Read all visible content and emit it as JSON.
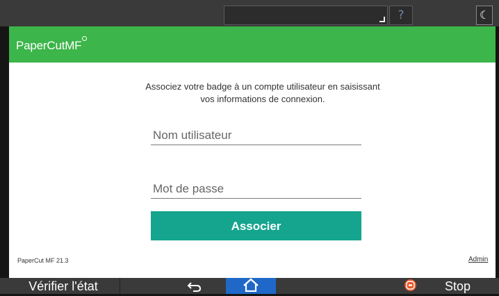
{
  "device_bar": {
    "help_glyph": "?",
    "night_glyph": "☾"
  },
  "app": {
    "logo_text": "PaperCut",
    "logo_suffix": "MF",
    "brand_color": "#3cb54a",
    "instructions_line1": "Associez votre badge à un compte utilisateur en saisissant",
    "instructions_line2": "vos informations de connexion.",
    "username_placeholder": "Nom utilisateur",
    "password_placeholder": "Mot de passe",
    "associate_label": "Associer",
    "associate_color": "#15a58f",
    "version_text": "PaperCut MF 21.3",
    "admin_link": "Admin"
  },
  "bottom_bar": {
    "status_label": "Vérifier l'état",
    "back_glyph": "⮌",
    "home_glyph": "⌂",
    "home_color": "#1f68c7",
    "stop_label": "Stop",
    "stop_color": "#e7572b"
  }
}
